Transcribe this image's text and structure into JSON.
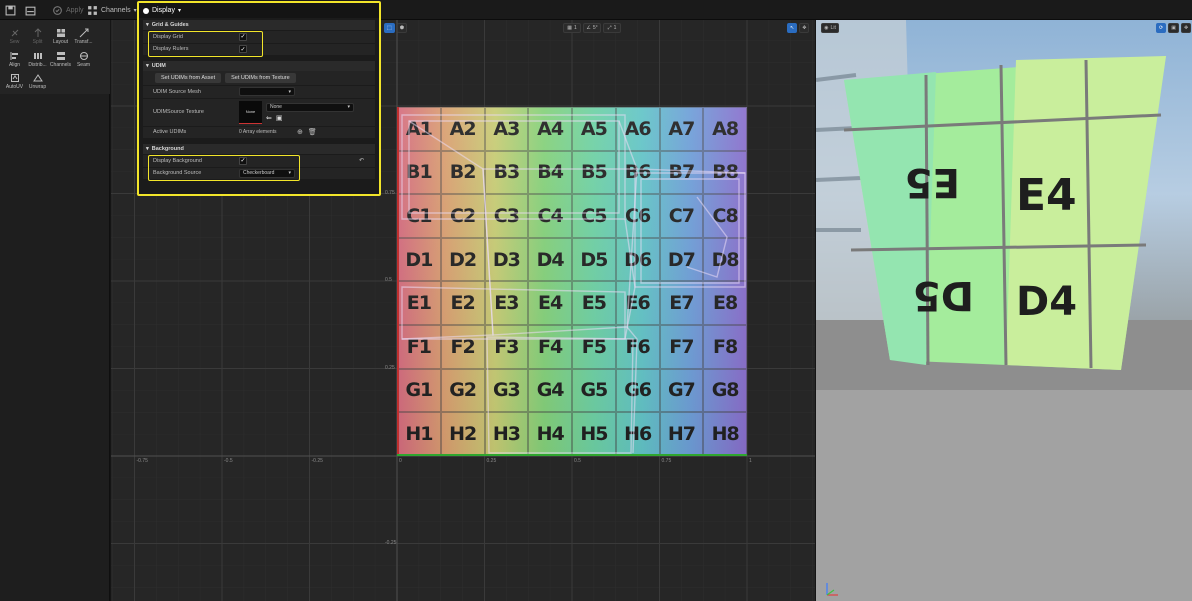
{
  "toolbar": {
    "apply_label": "Apply",
    "channels_label": "Channels"
  },
  "tools": [
    {
      "label": "Sew",
      "icon": "sew-icon",
      "enabled": false
    },
    {
      "label": "Split",
      "icon": "split-icon",
      "enabled": false
    },
    {
      "label": "Layout",
      "icon": "layout-icon",
      "enabled": true
    },
    {
      "label": "Transf...",
      "icon": "transform-icon",
      "enabled": true
    },
    {
      "label": "Align",
      "icon": "align-icon",
      "enabled": true
    },
    {
      "label": "Distrib...",
      "icon": "distribute-icon",
      "enabled": true
    },
    {
      "label": "Channels",
      "icon": "channels-icon",
      "enabled": true
    },
    {
      "label": "Seam",
      "icon": "seam-icon",
      "enabled": true
    },
    {
      "label": "AutoUV",
      "icon": "autouv-icon",
      "enabled": true
    },
    {
      "label": "Unwrap",
      "icon": "unwrap-icon",
      "enabled": true
    }
  ],
  "viewport": {
    "grid_count_label": "1",
    "snap_angle_label": "5°",
    "scale_label": "1",
    "axis_labels": {
      "x": [
        "-0.75",
        "-0.5",
        "-0.25",
        "0",
        "0.25",
        "0.5",
        "0.75",
        "1"
      ],
      "y": [
        "0.75",
        "0.5",
        "0.25",
        "-0.25"
      ]
    },
    "rows": [
      "A",
      "B",
      "C",
      "D",
      "E",
      "F",
      "G",
      "H"
    ],
    "cols": [
      "1",
      "2",
      "3",
      "4",
      "5",
      "6",
      "7",
      "8"
    ]
  },
  "details": {
    "title": "Display",
    "grid_guides": {
      "header": "Grid & Guides",
      "display_grid_label": "Display Grid",
      "display_grid_checked": true,
      "display_rulers_label": "Display Rulers",
      "display_rulers_checked": true
    },
    "udim": {
      "header": "UDIM",
      "set_from_asset_label": "Set UDIMs from Asset",
      "set_from_texture_label": "Set UDIMs from Texture",
      "source_mesh_label": "UDIM Source Mesh",
      "source_mesh_value": "",
      "source_texture_label": "UDIMSource Texture",
      "texture_thumb_label": "None",
      "texture_value": "None",
      "active_udims_label": "Active UDIMs",
      "active_udims_value": "0 Array elements"
    },
    "background": {
      "header": "Background",
      "display_background_label": "Display Background",
      "display_background_checked": true,
      "background_source_label": "Background Source",
      "background_source_value": "Checkerboard"
    }
  },
  "preview": {
    "lit_label": "Lit"
  },
  "colors": {
    "highlight": "#f2e52a",
    "accent": "#2a6cc0"
  }
}
